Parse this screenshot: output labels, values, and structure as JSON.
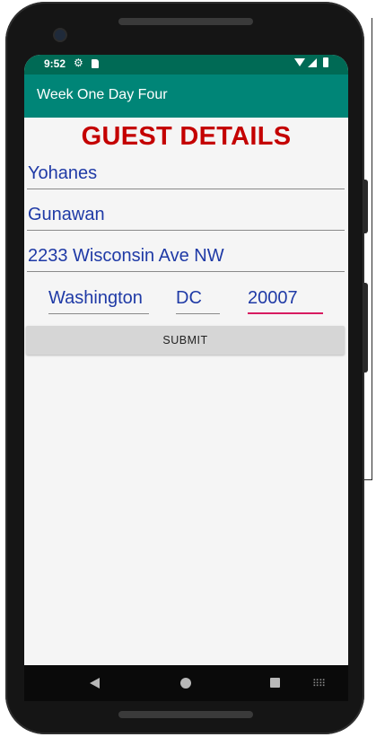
{
  "status_bar": {
    "time": "9:52",
    "icons": [
      "gear-icon",
      "sd-card-icon",
      "wifi-icon",
      "signal-icon",
      "battery-icon"
    ]
  },
  "app_bar": {
    "title": "Week One Day Four",
    "color": "#008577"
  },
  "form": {
    "heading": "GUEST DETAILS",
    "heading_color": "#c40000",
    "first_name": "Yohanes",
    "last_name": "Gunawan",
    "street": "2233 Wisconsin Ave NW",
    "city": "Washington",
    "state": "DC",
    "zip": "20007",
    "text_color": "#1f3aa6",
    "focused_underline_color": "#d81b60",
    "submit_label": "SUBMIT"
  },
  "nav_bar": {
    "icons": [
      "back-icon",
      "home-icon",
      "recents-icon",
      "keyboard-icon"
    ]
  }
}
